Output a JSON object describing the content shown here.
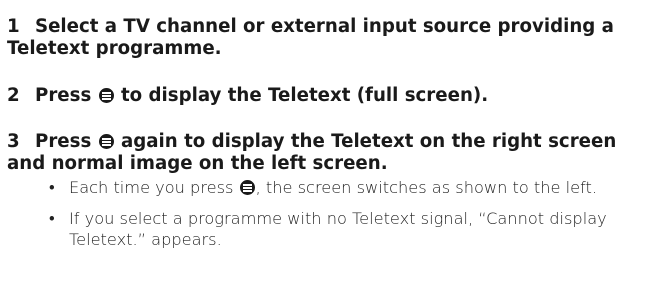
{
  "steps": [
    {
      "number": "1",
      "text": "Select a TV channel or external input source providing a Teletext programme."
    },
    {
      "number": "2",
      "before_icon": "Press",
      "icon": "teletext-button-icon",
      "after_icon": "to display the Teletext (full screen)."
    },
    {
      "number": "3",
      "before_icon": "Press",
      "icon": "teletext-button-icon",
      "after_icon": "again to display the Teletext on the right screen and normal image on the left screen."
    }
  ],
  "bullets": [
    {
      "bullet": "•",
      "before_icon": "Each time you press",
      "icon": "teletext-button-icon",
      "after_icon": ", the screen switches as shown to the left."
    },
    {
      "bullet": "•",
      "text": "If you select a programme with no Teletext signal, “Cannot display Teletext.” appears."
    }
  ]
}
